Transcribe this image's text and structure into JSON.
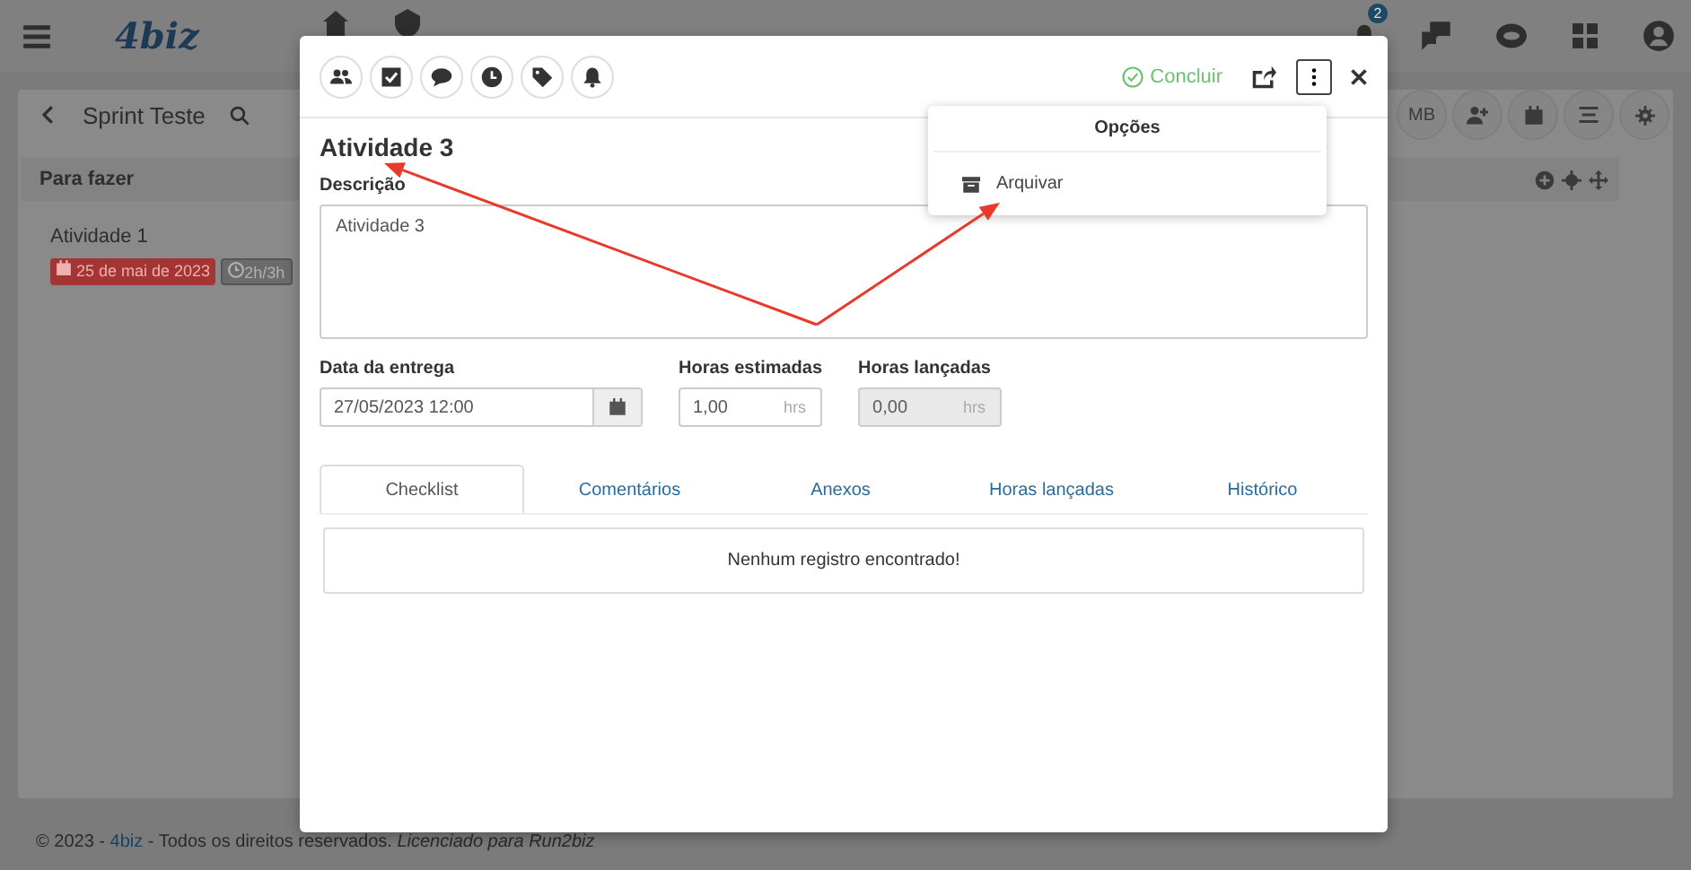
{
  "topbar": {
    "logo": "4biz",
    "notification_count": "2"
  },
  "board": {
    "title": "Sprint Teste",
    "avatar": "MB",
    "columns": [
      {
        "title": "Para fazer",
        "cards": [
          {
            "title": "Atividade 1",
            "due": "25 de mai de 2023",
            "hours": "2h/3h"
          }
        ]
      }
    ]
  },
  "footer": {
    "prefix": "© 2023 -",
    "link": "4biz",
    "suffix": "- Todos os direitos reservados. *Licenciado para Run2biz*"
  },
  "modal": {
    "toolbar": [
      {
        "kind": "people"
      },
      {
        "kind": "checkbox"
      },
      {
        "kind": "comment"
      },
      {
        "kind": "clock"
      },
      {
        "kind": "tag"
      },
      {
        "kind": "bell"
      }
    ],
    "complete_label": "Concluir",
    "title": "Atividade 3",
    "description_label": "Descrição",
    "description": "Atividade 3",
    "fields": [
      {
        "kind": "date",
        "label": "Data da entrega",
        "value": "27/05/2023 12:00",
        "disabled": false
      },
      {
        "kind": "hours",
        "label": "Horas estimadas",
        "value": "1,00",
        "unit": "hrs",
        "disabled": false
      },
      {
        "kind": "hours",
        "label": "Horas lançadas",
        "value": "0,00",
        "unit": "hrs",
        "disabled": true
      }
    ],
    "tabs": [
      {
        "label": "Checklist",
        "selected": true
      },
      {
        "label": "Comentários",
        "selected": false
      },
      {
        "label": "Anexos",
        "selected": false
      },
      {
        "label": "Horas lançadas",
        "selected": false
      },
      {
        "label": "Histórico",
        "selected": false
      }
    ],
    "empty_message": "Nenhum registro encontrado!"
  },
  "options_menu": {
    "title": "Opções",
    "items": [
      {
        "label": "Arquivar"
      }
    ]
  }
}
